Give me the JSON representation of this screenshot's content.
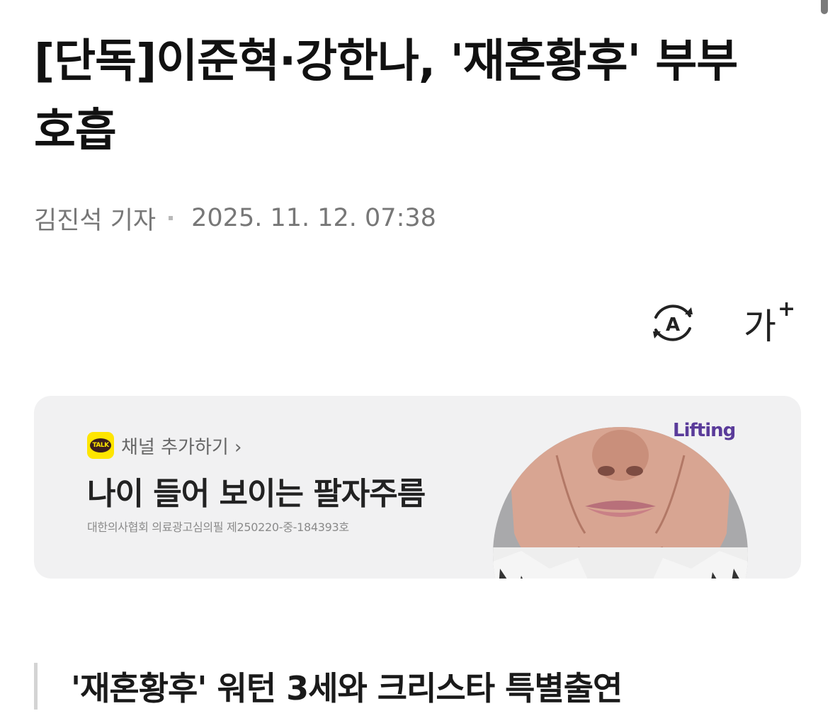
{
  "article": {
    "headline": "[단독]이준혁·강한나, '재혼황후' 부부 호흡",
    "reporter": "김진석 기자",
    "date": "2025. 11. 12. 07:38",
    "subheading": "'재혼황후' 워턴 3세와 크리스타 특별출연"
  },
  "toolbar": {
    "tts_icon": "read-aloud-icon",
    "tts_glyph": "A",
    "font_icon": "font-size-icon",
    "font_glyph": "가",
    "font_plus": "+"
  },
  "ad": {
    "channel_badge": "TALK",
    "channel_text": "채널 추가하기 ›",
    "title": "나이 들어 보이는 팔자주름",
    "note": "대한의사협회 의료광고심의필 제250220-중-184393호",
    "logo": "Lifting",
    "colors": {
      "background": "#f1f1f2",
      "kakao": "#fee500",
      "logo": "#5a3b9a"
    }
  }
}
